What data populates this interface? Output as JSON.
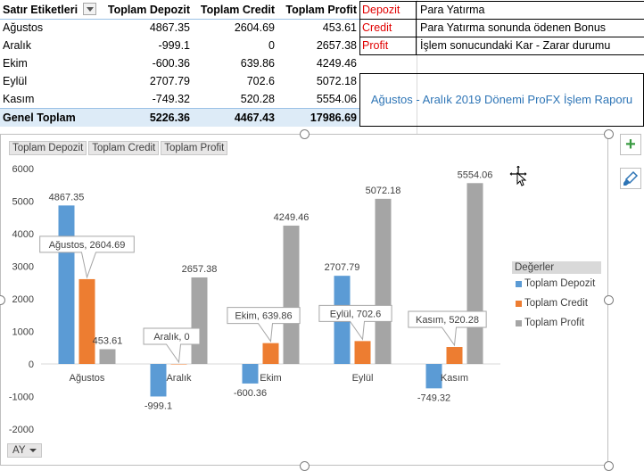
{
  "pivot": {
    "headers": [
      "Satır Etiketleri",
      "Toplam Depozit",
      "Toplam Credit",
      "Toplam Profit"
    ],
    "rows": [
      {
        "label": "Ağustos",
        "depozit": "4867.35",
        "credit": "2604.69",
        "profit": "453.61"
      },
      {
        "label": "Aralık",
        "depozit": "-999.1",
        "credit": "0",
        "profit": "2657.38"
      },
      {
        "label": "Ekim",
        "depozit": "-600.36",
        "credit": "639.86",
        "profit": "4249.46"
      },
      {
        "label": "Eylül",
        "depozit": "2707.79",
        "credit": "702.6",
        "profit": "5072.18"
      },
      {
        "label": "Kasım",
        "depozit": "-749.32",
        "credit": "520.28",
        "profit": "5554.06"
      }
    ],
    "total": {
      "label": "Genel Toplam",
      "depozit": "5226.36",
      "credit": "4467.43",
      "profit": "17986.69"
    }
  },
  "definitions": [
    {
      "key": "Depozit",
      "value": "Para Yatırma"
    },
    {
      "key": "Credit",
      "value": "Para Yatırma sonunda ödenen Bonus"
    },
    {
      "key": "Profit",
      "value": "İşlem sonucundaki Kar - Zarar durumu"
    }
  ],
  "report_title": "Ağustos - Aralık 2019 Dönemi ProFX İşlem Raporu",
  "field_buttons": [
    "Toplam Depozit",
    "Toplam Credit",
    "Toplam Profit"
  ],
  "filter_button": "AY",
  "legend": {
    "title": "Değerler",
    "items": [
      {
        "name": "Toplam Depozit",
        "color": "#5b9bd5"
      },
      {
        "name": "Toplam Credit",
        "color": "#ed7d31"
      },
      {
        "name": "Toplam Profit",
        "color": "#a5a5a5"
      }
    ]
  },
  "side_buttons": {
    "add_icon": "plus-icon",
    "style_icon": "paintbrush-icon"
  },
  "chart_data": {
    "type": "bar",
    "categories": [
      "Ağustos",
      "Aralık",
      "Ekim",
      "Eylül",
      "Kasım"
    ],
    "series": [
      {
        "name": "Toplam Depozit",
        "values": [
          4867.35,
          -999.1,
          -600.36,
          2707.79,
          -749.32
        ],
        "color": "#5b9bd5"
      },
      {
        "name": "Toplam Credit",
        "values": [
          2604.69,
          0,
          639.86,
          702.6,
          520.28
        ],
        "color": "#ed7d31"
      },
      {
        "name": "Toplam Profit",
        "values": [
          453.61,
          2657.38,
          4249.46,
          5072.18,
          5554.06
        ],
        "color": "#a5a5a5"
      }
    ],
    "ylim": [
      -2000,
      6000
    ],
    "yticks": [
      -2000,
      -1000,
      0,
      1000,
      2000,
      3000,
      4000,
      5000,
      6000
    ],
    "data_labels": {
      "depozit": [
        "4867.35",
        "-999.1",
        "-600.36",
        "2707.79",
        "-749.32"
      ],
      "profit": [
        "453.61",
        "2657.38",
        "4249.46",
        "5072.18",
        "5554.06"
      ]
    },
    "callouts": [
      "Ağustos, 2604.69",
      "Aralık, 0",
      "Ekim, 639.86",
      "Eylül, 702.6",
      "Kasım, 520.28"
    ],
    "grid": false,
    "legend_position": "right"
  }
}
